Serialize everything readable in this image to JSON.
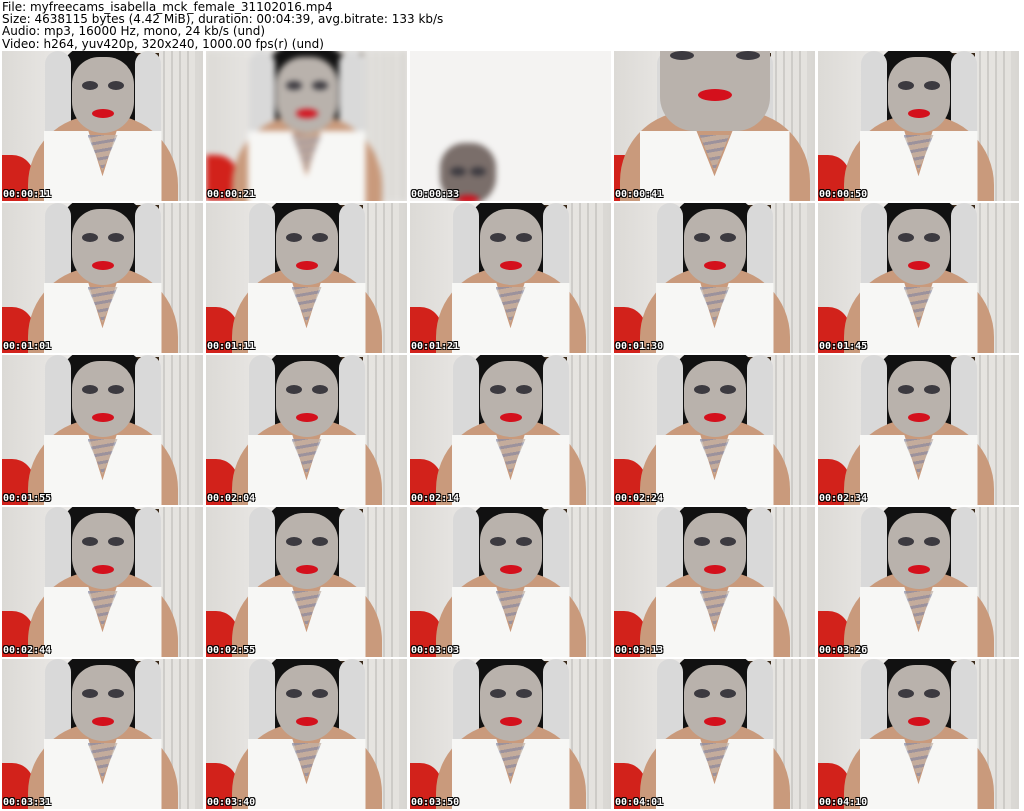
{
  "header": {
    "file_line": "File: myfreecams_isabella_mck_female_31102016.mp4",
    "size_line": "Size: 4638115 bytes (4.42 MiB), duration: 00:04:39, avg.bitrate: 133 kb/s",
    "audio_line": "Audio: mp3, 16000 Hz, mono, 24 kb/s (und)",
    "video_line": "Video: h264, yuv420p, 320x240, 1000.00 fps(r) (und)"
  },
  "thumbnails": [
    {
      "timestamp": "00:00:11"
    },
    {
      "timestamp": "00:00:21"
    },
    {
      "timestamp": "00:00:33"
    },
    {
      "timestamp": "00:00:41"
    },
    {
      "timestamp": "00:00:50"
    },
    {
      "timestamp": "00:01:01"
    },
    {
      "timestamp": "00:01:11"
    },
    {
      "timestamp": "00:01:21"
    },
    {
      "timestamp": "00:01:30"
    },
    {
      "timestamp": "00:01:45"
    },
    {
      "timestamp": "00:01:55"
    },
    {
      "timestamp": "00:02:04"
    },
    {
      "timestamp": "00:02:14"
    },
    {
      "timestamp": "00:02:24"
    },
    {
      "timestamp": "00:02:34"
    },
    {
      "timestamp": "00:02:44"
    },
    {
      "timestamp": "00:02:55"
    },
    {
      "timestamp": "00:03:03"
    },
    {
      "timestamp": "00:03:13"
    },
    {
      "timestamp": "00:03:26"
    },
    {
      "timestamp": "00:03:31"
    },
    {
      "timestamp": "00:03:40"
    },
    {
      "timestamp": "00:03:50"
    },
    {
      "timestamp": "00:04:01"
    },
    {
      "timestamp": "00:04:10"
    }
  ]
}
